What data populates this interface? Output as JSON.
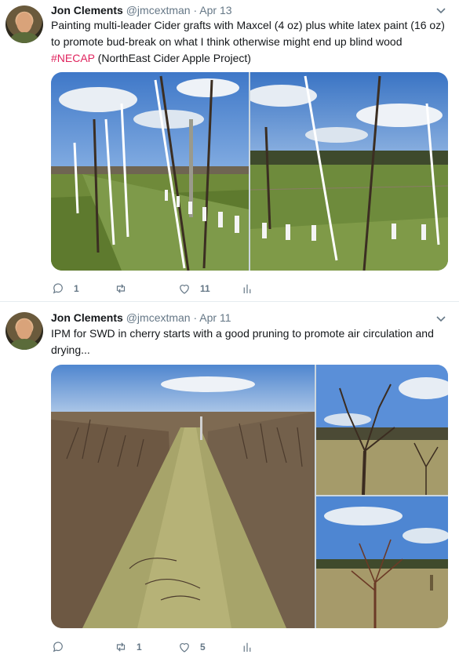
{
  "tweets": [
    {
      "author_name": "Jon Clements",
      "handle": "@jmcextman",
      "separator": "·",
      "date": "Apr 13",
      "text_lines": [
        "Painting multi-leader Cider grafts with Maxcel (4 oz) plus white latex paint (16 oz)",
        "to promote bud-break on what I think otherwise might end up blind wood"
      ],
      "hashtag": "#NECAP",
      "hashtag_suffix": " (NorthEast Cider Apple Project)",
      "replies": "1",
      "retweets": "",
      "likes": "11"
    },
    {
      "author_name": "Jon Clements",
      "handle": "@jmcextman",
      "separator": "·",
      "date": "Apr 11",
      "text_lines": [
        "IPM for SWD in cherry starts with a good pruning to promote air circulation and",
        "drying..."
      ],
      "replies": "",
      "retweets": "1",
      "likes": "5"
    }
  ],
  "icons": {
    "reply": "reply-icon",
    "retweet": "retweet-icon",
    "like": "heart-icon",
    "analytics": "analytics-icon",
    "more": "chevron-down-icon"
  },
  "colors": {
    "text": "#14171a",
    "secondary": "#657786",
    "hashtag": "#e0245e",
    "divider": "#e6ecf0"
  }
}
